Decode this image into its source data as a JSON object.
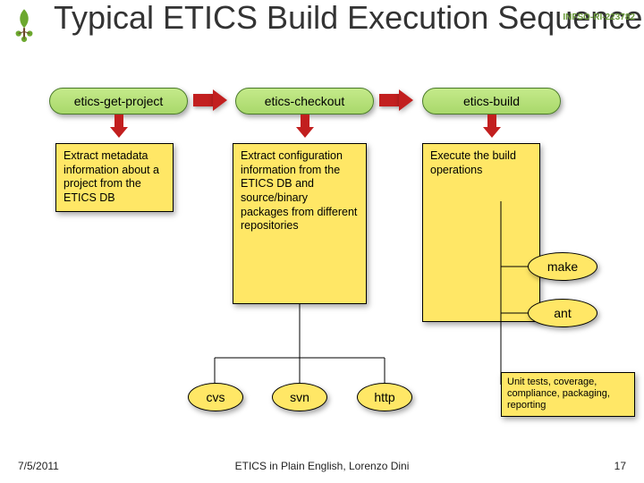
{
  "title": "Typical ETICS Build Execution Sequence",
  "proj_id": "INFSO-RI-223782",
  "cmds": {
    "a": "etics-get-project",
    "b": "etics-checkout",
    "c": "etics-build"
  },
  "desc": {
    "a": "Extract metadata information about a project from the ETICS DB",
    "b": "Extract configuration information from the ETICS DB and source/binary packages from different repositories",
    "c": "Execute the build operations"
  },
  "ovals": {
    "cvs": "cvs",
    "svn": "svn",
    "http": "http",
    "make": "make",
    "ant": "ant"
  },
  "note": "Unit tests, coverage, compliance, packaging, reporting",
  "footer": {
    "date": "7/5/2011",
    "center": "ETICS in Plain English, Lorenzo Dini",
    "page": "17"
  }
}
